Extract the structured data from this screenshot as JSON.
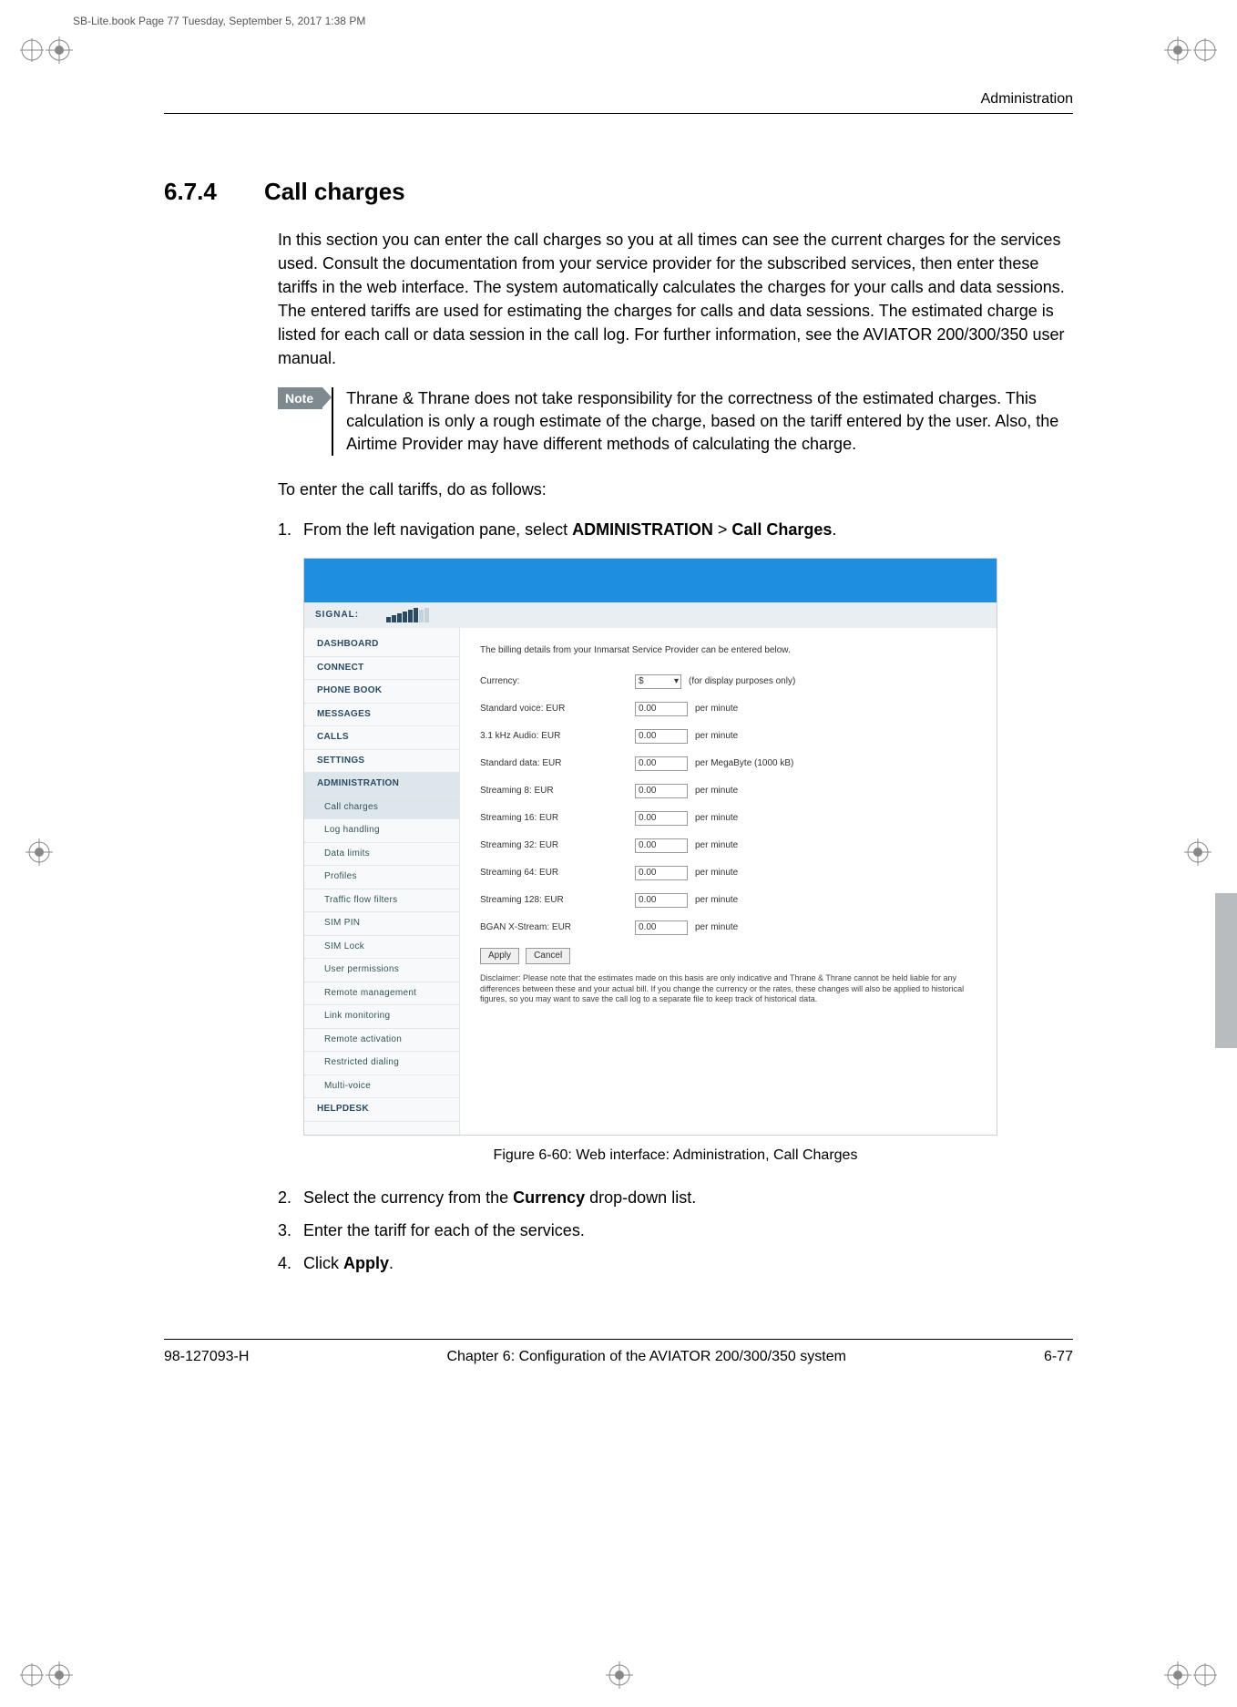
{
  "meta": {
    "crop_text": "SB-Lite.book  Page 77  Tuesday, September 5, 2017  1:38 PM"
  },
  "header": {
    "running": "Administration"
  },
  "section": {
    "number": "6.7.4",
    "title": "Call charges",
    "intro": "In this section you can enter the call charges so you at all times can see the current charges for the services used. Consult the documentation from your service provider for the subscribed services, then enter these tariffs in the web interface. The system automatically calculates the charges for your calls and data sessions. The entered tariffs are used for estimating the charges for calls and data sessions. The estimated charge is listed for each call or data session in the call log. For further information, see the AVIATOR 200/300/350 user manual.",
    "note_label": "Note",
    "note_text": "Thrane & Thrane does not take responsibility for the correctness of the estimated charges. This calculation is only a rough estimate of the charge, based on the tariff entered by the user. Also, the Airtime Provider may have different methods of calculating the charge.",
    "lead_in": "To enter the call tariffs, do as follows:",
    "step1_pre": "From the left navigation pane, select ",
    "step1_b1": "ADMINISTRATION",
    "step1_mid": " > ",
    "step1_b2": "Call Charges",
    "step1_post": ".",
    "step2_pre": "Select the currency from the ",
    "step2_b": "Currency",
    "step2_post": " drop-down list.",
    "step3": "Enter the tariff for each of the services.",
    "step4_pre": "Click ",
    "step4_b": "Apply",
    "step4_post": "."
  },
  "screenshot": {
    "signal_label": "SIGNAL:",
    "nav": {
      "dashboard": "DASHBOARD",
      "connect": "CONNECT",
      "phone_book": "PHONE BOOK",
      "messages": "MESSAGES",
      "calls": "CALLS",
      "settings": "SETTINGS",
      "administration": "ADMINISTRATION",
      "call_charges": "Call charges",
      "log_handling": "Log handling",
      "data_limits": "Data limits",
      "profiles": "Profiles",
      "traffic_flow_filters": "Traffic flow filters",
      "sim_pin": "SIM PIN",
      "sim_lock": "SIM Lock",
      "user_permissions": "User permissions",
      "remote_management": "Remote management",
      "link_monitoring": "Link monitoring",
      "remote_activation": "Remote activation",
      "restricted_dialing": "Restricted dialing",
      "multi_voice": "Multi-voice",
      "helpdesk": "HELPDESK"
    },
    "content": {
      "intro": "The billing details from your Inmarsat Service Provider can be entered below.",
      "currency_label": "Currency:",
      "currency_value": "$",
      "currency_note": "(for display purposes only)",
      "fields": {
        "std_voice": "Standard voice: EUR",
        "audio31": "3.1 kHz Audio: EUR",
        "std_data": "Standard data: EUR",
        "s8": "Streaming 8: EUR",
        "s16": "Streaming 16: EUR",
        "s32": "Streaming 32: EUR",
        "s64": "Streaming 64: EUR",
        "s128": "Streaming 128: EUR",
        "bgan": "BGAN X-Stream: EUR"
      },
      "value_default": "0.00",
      "unit_minute": "per minute",
      "unit_mb": "per MegaByte (1000 kB)",
      "apply": "Apply",
      "cancel": "Cancel",
      "disclaimer": "Disclaimer: Please note that the estimates made on this basis are only indicative and Thrane & Thrane cannot be held liable for any differences between these and your actual bill. If you change the currency or the rates, these changes will also be applied to historical figures, so you may want to save the call log to a separate file to keep track of historical data."
    }
  },
  "figure_caption": "Figure 6-60: Web interface: Administration, Call Charges",
  "footer": {
    "left": "98-127093-H",
    "center": "Chapter 6:  Configuration of the AVIATOR 200/300/350 system",
    "right": "6-77"
  }
}
